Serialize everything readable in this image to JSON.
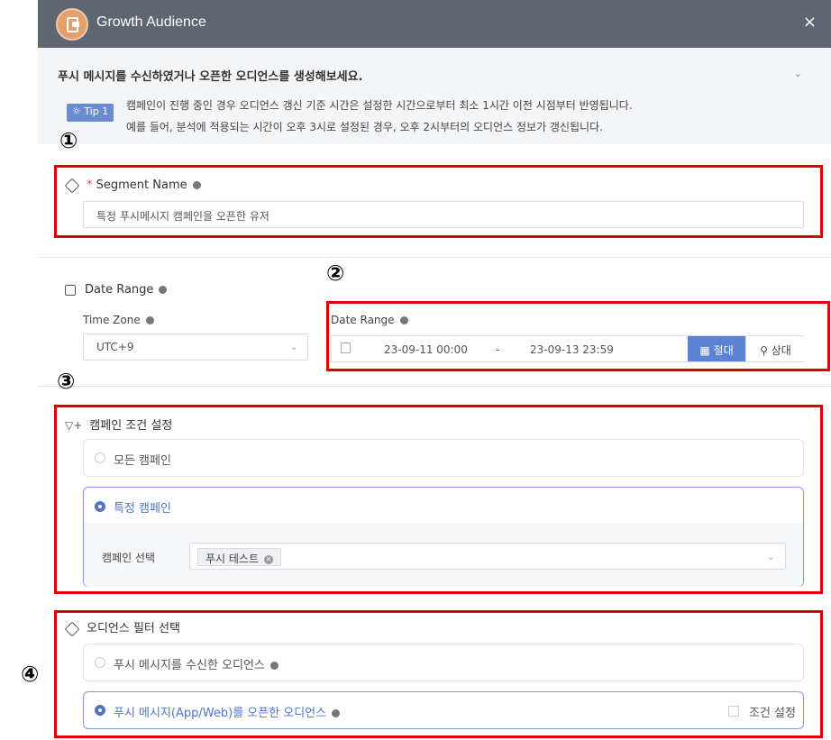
{
  "header": {
    "title": "Growth Audience",
    "close": "×"
  },
  "info": {
    "headline": "푸시 메시지를 수신하였거나 오픈한 오디언스를 생성해보세요.",
    "tip_label": "Tip 1",
    "line1": "캠페인이 진행 중인 경우 오디언스 갱신 기준 시간은 설정한 시간으로부터 최소 1시간 이전 시점부터 반영됩니다.",
    "line2": "예를 들어, 분석에 적용되는 시간이 오후 3시로 설정된 경우, 오후 2시부터의 오디언스 정보가 갱신됩니다."
  },
  "markers": {
    "m1": "①",
    "m2": "②",
    "m3": "③",
    "m4": "④"
  },
  "segment": {
    "required_mark": "*",
    "label": "Segment Name",
    "value": "특정 푸시메시지 캠페인을 오픈한 유저"
  },
  "date_section": {
    "label": "Date Range",
    "timezone_label": "Time Zone",
    "timezone_value": "UTC+9",
    "range_label": "Date Range",
    "start": "23-09-11 00:00",
    "dash": "-",
    "end": "23-09-13 23:59",
    "absolute_button": "절대",
    "relative_button": "상대"
  },
  "campaign": {
    "title": "캠페인 조건 설정",
    "option_all": "모든 캠페인",
    "option_specific": "특정 캠페인",
    "select_label": "캠페인 선택",
    "selected_chip": "푸시 테스트"
  },
  "audience": {
    "title": "오디언스 필터 선택",
    "option_received": "푸시 메시지를 수신한 오디언스",
    "option_opened": "푸시 메시지(App/Web)를 오픈한 오디언스",
    "condition_label": "조건 설정"
  },
  "colors": {
    "header_bg": "#5f6672",
    "accent": "#4f75c9",
    "highlight_box": "#e00000"
  }
}
